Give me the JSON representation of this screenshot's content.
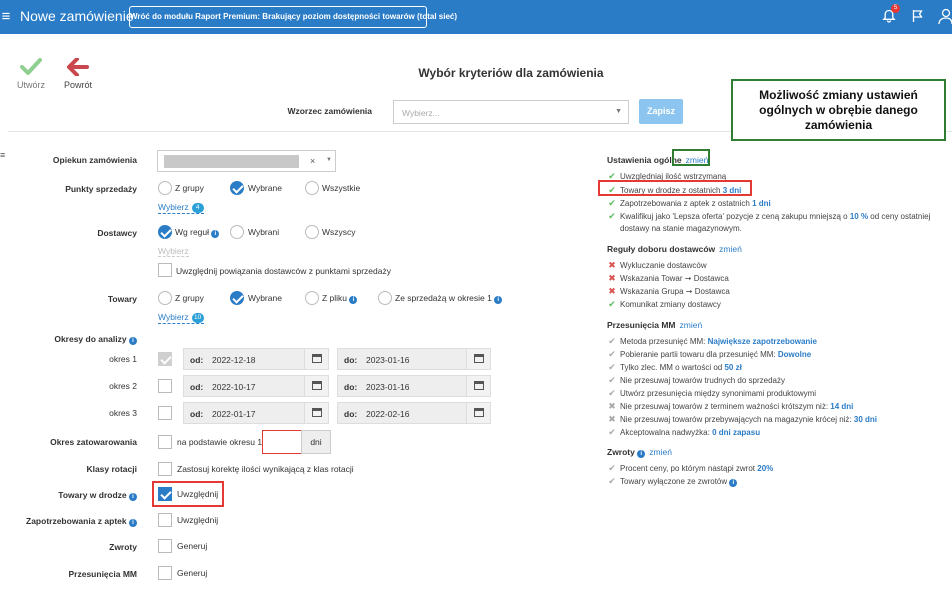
{
  "header": {
    "title": "Nowe zamówienie",
    "back_button": "Wróć do modułu Raport Premium: Brakujący poziom dostępności towarów (total sieć)",
    "notifications": "5"
  },
  "toolbar": {
    "create": "Utwórz",
    "back": "Powrót"
  },
  "page_title": "Wybór kryteriów dla zamówienia",
  "template": {
    "label": "Wzorzec zamówienia",
    "placeholder": "Wybierz...",
    "button": "Zapisz"
  },
  "callout": "Możliwość zmiany ustawień ogólnych w obrębie danego zamówienia",
  "form": {
    "opiekun": {
      "label": "Opiekun zamówienia",
      "clear": "×"
    },
    "punkty": {
      "label": "Punkty sprzedaży",
      "options": [
        "Z grupy",
        "Wybrane",
        "Wszystkie"
      ],
      "link": "Wybierz",
      "count": "4"
    },
    "dostawcy": {
      "label": "Dostawcy",
      "options": [
        "Wg reguł",
        "Wybrani",
        "Wszyscy"
      ],
      "link": "Wybierz",
      "check": "Uwzględnij powiązania dostawców z punktami sprzedaży"
    },
    "towary": {
      "label": "Towary",
      "options": [
        "Z grupy",
        "Wybrane",
        "Z pliku",
        "Ze sprzedażą w okresie 1"
      ],
      "link": "Wybierz",
      "count": "10"
    },
    "okresy": {
      "label": "Okresy do analizy",
      "rows": [
        {
          "label": "okres 1",
          "od": "od:",
          "from": "2022-12-18",
          "do": "do:",
          "to": "2023-01-16"
        },
        {
          "label": "okres 2",
          "od": "od:",
          "from": "2022-10-17",
          "do": "do:",
          "to": "2023-01-16"
        },
        {
          "label": "okres 3",
          "od": "od:",
          "from": "2022-01-17",
          "do": "do:",
          "to": "2022-02-16"
        }
      ]
    },
    "zatowarowania": {
      "label": "Okres zatowarowania",
      "text": "na podstawie okresu 1",
      "unit": "dni"
    },
    "klasy": {
      "label": "Klasy rotacji",
      "text": "Zastosuj korektę ilości wynikającą z klas rotacji"
    },
    "towary_drodze": {
      "label": "Towary w drodze",
      "text": "Uwzględnij"
    },
    "zapotrzebowania": {
      "label": "Zapotrzebowania z aptek",
      "text": "Uwzględnij"
    },
    "zwroty": {
      "label": "Zwroty",
      "text": "Generuj"
    },
    "przesuniecia": {
      "label": "Przesunięcia MM",
      "text": "Generuj"
    }
  },
  "right": {
    "general": {
      "title": "Ustawienia ogólne",
      "change": "zmień",
      "items": [
        {
          "icon": "check",
          "pre": "Uwzględniaj ilość wstrzymaną",
          "val": "",
          "post": ""
        },
        {
          "icon": "check",
          "pre": "Towary w drodze z ostatnich ",
          "val": "3 dni",
          "post": ""
        },
        {
          "icon": "check",
          "pre": "Zapotrzebowania z aptek z ostatnich ",
          "val": "1 dni",
          "post": ""
        },
        {
          "icon": "check",
          "pre": "Kwalifikuj jako 'Lepsza oferta' pozycje z ceną zakupu mniejszą o ",
          "val": "10 %",
          "post": " od ceny ostatniej"
        }
      ],
      "cont": "dostawy na stanie magazynowym."
    },
    "rules": {
      "title": "Reguły doboru dostawców",
      "change": "zmień",
      "items": [
        {
          "icon": "x",
          "pre": "Wykluczanie dostawców",
          "val": "",
          "post": ""
        },
        {
          "icon": "x",
          "pre": "Wskazania Towar ➞ Dostawca",
          "val": "",
          "post": ""
        },
        {
          "icon": "x",
          "pre": "Wskazania Grupa ➞ Dostawca",
          "val": "",
          "post": ""
        },
        {
          "icon": "check",
          "pre": "Komunikat zmiany dostawcy",
          "val": "",
          "post": ""
        }
      ]
    },
    "mm": {
      "title": "Przesunięcia MM",
      "change": "zmień",
      "items": [
        {
          "icon": "grey",
          "pre": "Metoda przesunięć MM: ",
          "val": "Największe zapotrzebowanie",
          "post": ""
        },
        {
          "icon": "grey",
          "pre": "Pobieranie partii towaru dla przesunięć MM: ",
          "val": "Dowolne",
          "post": ""
        },
        {
          "icon": "grey",
          "pre": "Tylko zlec. MM o wartości od ",
          "val": "50 zł",
          "post": ""
        },
        {
          "icon": "grey",
          "pre": "Nie przesuwaj towarów trudnych do sprzedaży",
          "val": "",
          "post": ""
        },
        {
          "icon": "grey",
          "pre": "Utwórz przesunięcia między synonimami produktowymi",
          "val": "",
          "post": ""
        },
        {
          "icon": "greyx",
          "pre": "Nie przesuwaj towarów z terminem ważności krótszym niż: ",
          "val": "14 dni",
          "post": ""
        },
        {
          "icon": "greyx",
          "pre": "Nie przesuwaj towarów przebywających na magazynie krócej niż: ",
          "val": "30 dni",
          "post": ""
        },
        {
          "icon": "grey",
          "pre": "Akceptowalna nadwyżka: ",
          "val": "0 dni zapasu",
          "post": ""
        }
      ]
    },
    "returns": {
      "title": "Zwroty",
      "change": "zmień",
      "items": [
        {
          "icon": "grey",
          "pre": "Procent ceny, po którym nastąpi zwrot ",
          "val": "20%",
          "post": ""
        },
        {
          "icon": "grey",
          "pre": "Towary wyłączone ze zwrotów",
          "val": "",
          "post": ""
        }
      ]
    }
  }
}
